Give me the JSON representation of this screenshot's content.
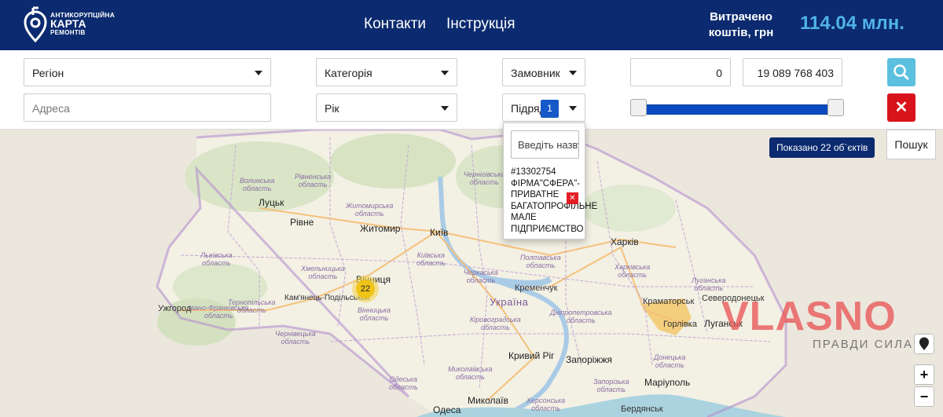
{
  "header": {
    "logo": {
      "line1": "АНТИКОРУПЦІЙНА",
      "line2": "КАРТА",
      "line3": "РЕМОНТІВ"
    },
    "nav": [
      "Контакти",
      "Інструкція"
    ],
    "spent_label_1": "Витрачено",
    "spent_label_2": "коштів, грн",
    "amount": "114.04 млн."
  },
  "filters": {
    "region": "Регіон",
    "category": "Категорія",
    "customer": "Замовник",
    "min": "0",
    "max": "19 089 768 403",
    "address_placeholder": "Адреса",
    "year": "Рік",
    "contractor": "Підряд",
    "contractor_count": "1",
    "clear_label": "✕"
  },
  "popup": {
    "search_placeholder": "Введіть назву",
    "item": "#13302754 ФІРМА\"СФЕРА\"-ПРИВАТНЕ БАГАТОПРОФІЛЬНЕ МАЛЕ ПІДПРИЄМСТВО",
    "remove_label": "✕"
  },
  "map": {
    "shown_label": "Показано 22 об`єктів",
    "search_button": "Пошук",
    "cluster_count": "22",
    "country": "Україна",
    "watermark": "VLASNO",
    "watermark_sub": "ПРАВДИ СИЛА",
    "zoom_in": "+",
    "zoom_out": "−",
    "cities": [
      "Луцьк",
      "Рівне",
      "Житомир",
      "Київ",
      "Харків",
      "Вінниця",
      "Кременчук",
      "Ужгород",
      "Кам'янець-Подільський",
      "Краматорськ",
      "Северодонецьк",
      "Горлівка",
      "Луганськ",
      "Кривий Ріг",
      "Запоріжжя",
      "Маріуполь",
      "Одеса",
      "Миколаїв",
      "Бердянськ"
    ],
    "oblasts": [
      "Волинська область",
      "Рівненська область",
      "Житомирська область",
      "Чернігівська область",
      "Львівська область",
      "Хмельницька область",
      "Вінницька область",
      "Київська область",
      "Черкаська область",
      "Полтавська область",
      "Харківська область",
      "Луганська область",
      "Донецька область",
      "Дніпропетровська область",
      "Кіровоградська область",
      "Запорізька область",
      "Миколаївська область",
      "Херсонська область",
      "Одеська область",
      "Тернопільська область",
      "Івано-Франківська область",
      "Чернівецька область"
    ]
  }
}
